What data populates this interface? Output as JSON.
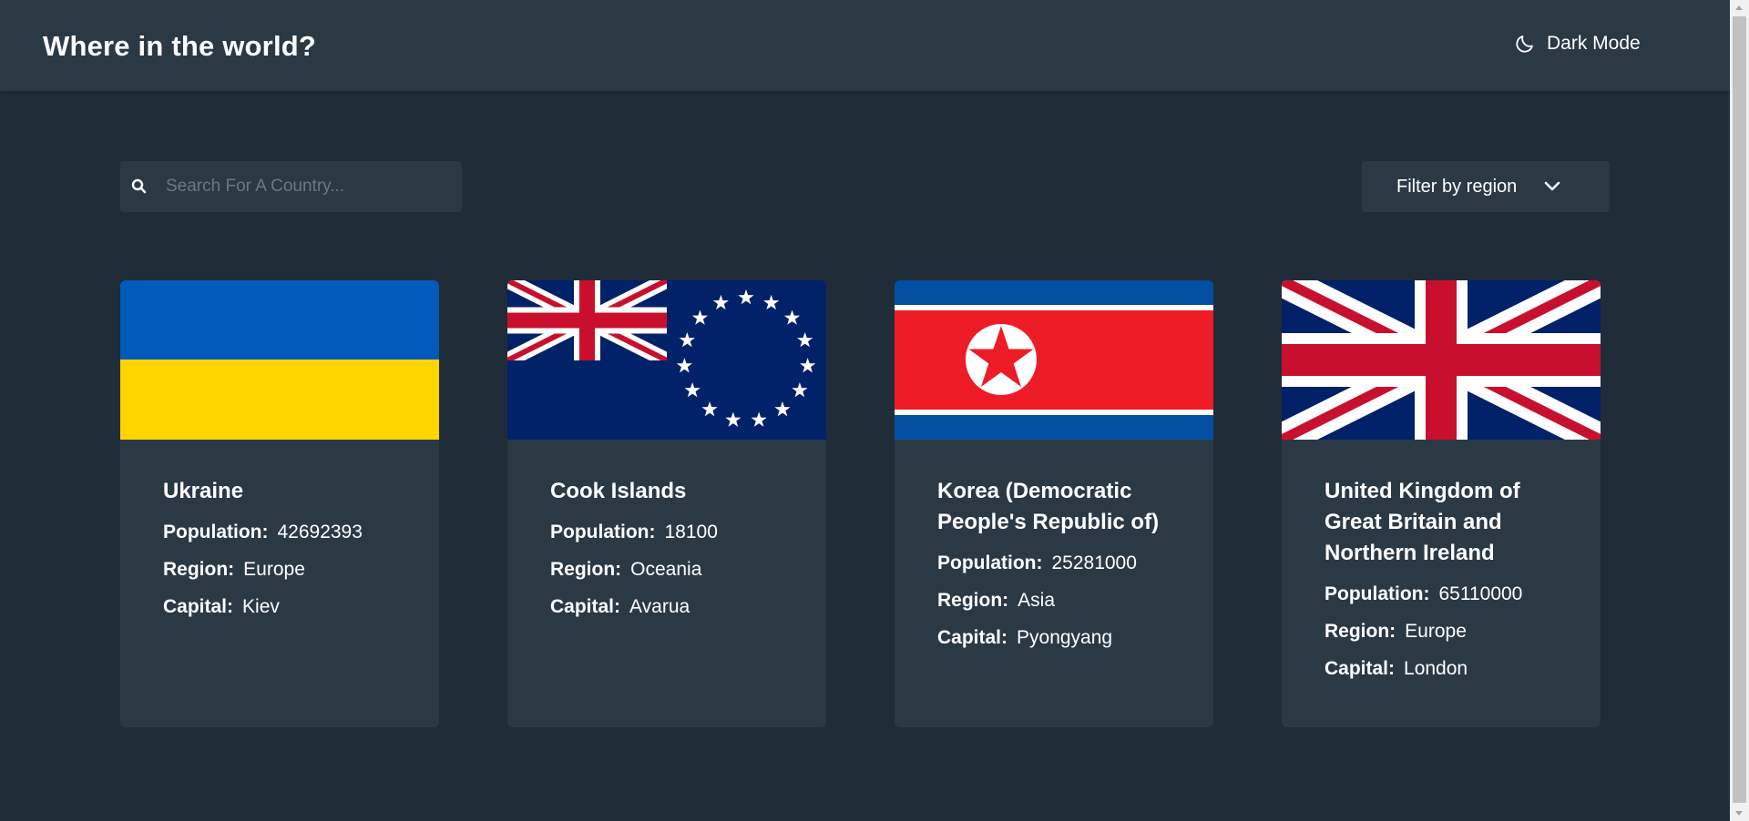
{
  "header": {
    "title": "Where in the world?",
    "dark_mode_label": "Dark Mode",
    "dark_mode_icon": "moon-icon"
  },
  "search": {
    "placeholder": "Search For A Country...",
    "value": "",
    "icon": "search-icon"
  },
  "filter": {
    "label": "Filter by region",
    "icon": "chevron-down-icon"
  },
  "labels": {
    "population": "Population:",
    "region": "Region:",
    "capital": "Capital:"
  },
  "countries": [
    {
      "name": "Ukraine",
      "population": "42692393",
      "region": "Europe",
      "capital": "Kiev",
      "flag": "ukraine-flag"
    },
    {
      "name": "Cook Islands",
      "population": "18100",
      "region": "Oceania",
      "capital": "Avarua",
      "flag": "cook-islands-flag"
    },
    {
      "name": "Korea (Democratic People's Republic of)",
      "population": "25281000",
      "region": "Asia",
      "capital": "Pyongyang",
      "flag": "north-korea-flag"
    },
    {
      "name": "United Kingdom of Great Britain and Northern Ireland",
      "population": "65110000",
      "region": "Europe",
      "capital": "London",
      "flag": "united-kingdom-flag"
    }
  ],
  "colors": {
    "background": "#202c37",
    "elements": "#2b3945",
    "text": "#ffffff",
    "placeholder": "#6c7883"
  }
}
